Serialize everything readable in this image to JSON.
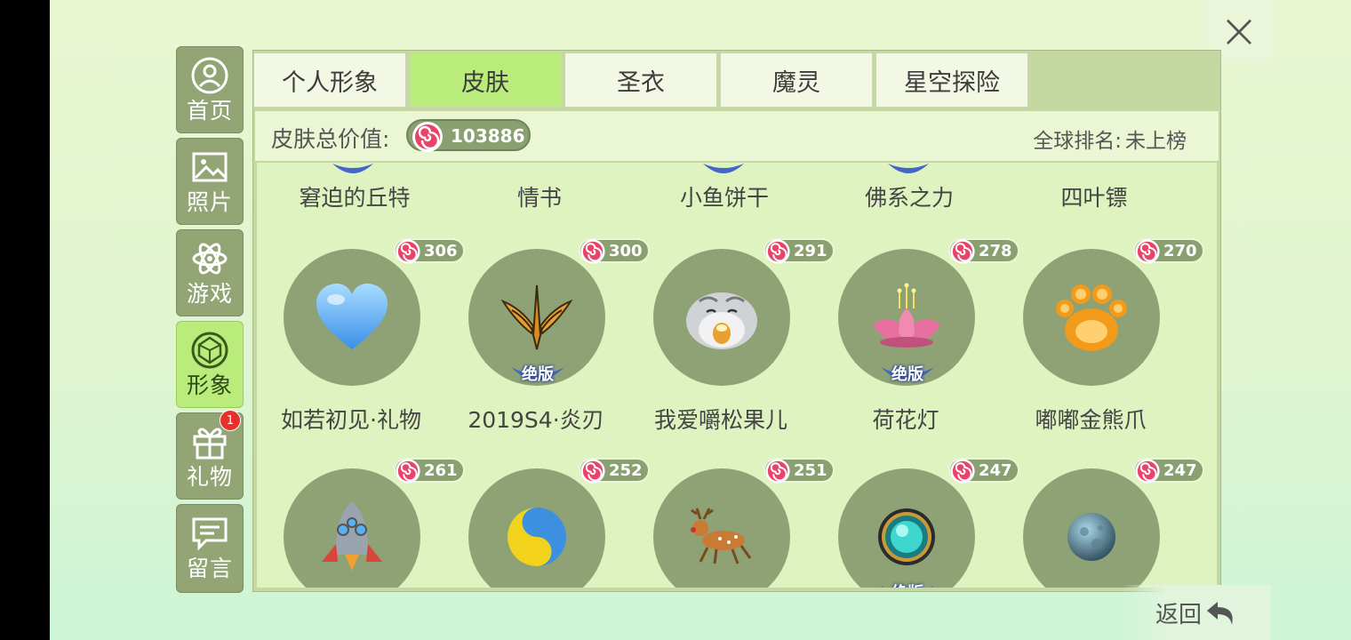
{
  "nav": [
    {
      "label": "首页",
      "icon": "profile-icon"
    },
    {
      "label": "照片",
      "icon": "photo-icon"
    },
    {
      "label": "游戏",
      "icon": "atom-icon"
    },
    {
      "label": "形象",
      "icon": "gem-icon",
      "active": true
    },
    {
      "label": "礼物",
      "icon": "gift-icon",
      "badge": "1"
    },
    {
      "label": "留言",
      "icon": "message-icon"
    }
  ],
  "tabs": [
    {
      "label": "个人形象"
    },
    {
      "label": "皮肤",
      "active": true
    },
    {
      "label": "圣衣"
    },
    {
      "label": "魔灵"
    },
    {
      "label": "星空探险"
    }
  ],
  "summary": {
    "label": "皮肤总价值:",
    "total_value": "103886",
    "rank_label": "全球排名:",
    "rank_value": "未上榜"
  },
  "partial_row": [
    {
      "name": "窘迫的丘特",
      "badge": true
    },
    {
      "name": "情书",
      "badge": false
    },
    {
      "name": "小鱼饼干",
      "badge": true
    },
    {
      "name": "佛系之力",
      "badge": true
    },
    {
      "name": "四叶镖",
      "badge": false
    }
  ],
  "items": [
    {
      "name": "如若初见·礼物",
      "price": "306",
      "icon": "heart-icon",
      "out_of_print": false
    },
    {
      "name": "2019S4·炎刃",
      "price": "300",
      "icon": "winged-blade-icon",
      "out_of_print": true
    },
    {
      "name": "我爱嚼松果儿",
      "price": "291",
      "icon": "hamster-icon",
      "out_of_print": false
    },
    {
      "name": "荷花灯",
      "price": "278",
      "icon": "lotus-lamp-icon",
      "out_of_print": true
    },
    {
      "name": "嘟嘟金熊爪",
      "price": "270",
      "icon": "bear-paw-icon",
      "out_of_print": false
    },
    {
      "name": "",
      "price": "261",
      "icon": "rocket-icon",
      "out_of_print": false
    },
    {
      "name": "",
      "price": "252",
      "icon": "yin-yang-icon",
      "out_of_print": false
    },
    {
      "name": "",
      "price": "251",
      "icon": "reindeer-icon",
      "out_of_print": false
    },
    {
      "name": "",
      "price": "247",
      "icon": "crystal-orb-icon",
      "out_of_print": true
    },
    {
      "name": "",
      "price": "247",
      "icon": "moon-icon",
      "out_of_print": false
    }
  ],
  "out_of_print_label": "绝版",
  "close_label": "×",
  "back_label": "返回",
  "colors": {
    "accent": "#b9ec7b",
    "panel": "#c6d8a2",
    "circle": "#8ea276",
    "badge": "#e8302a"
  }
}
